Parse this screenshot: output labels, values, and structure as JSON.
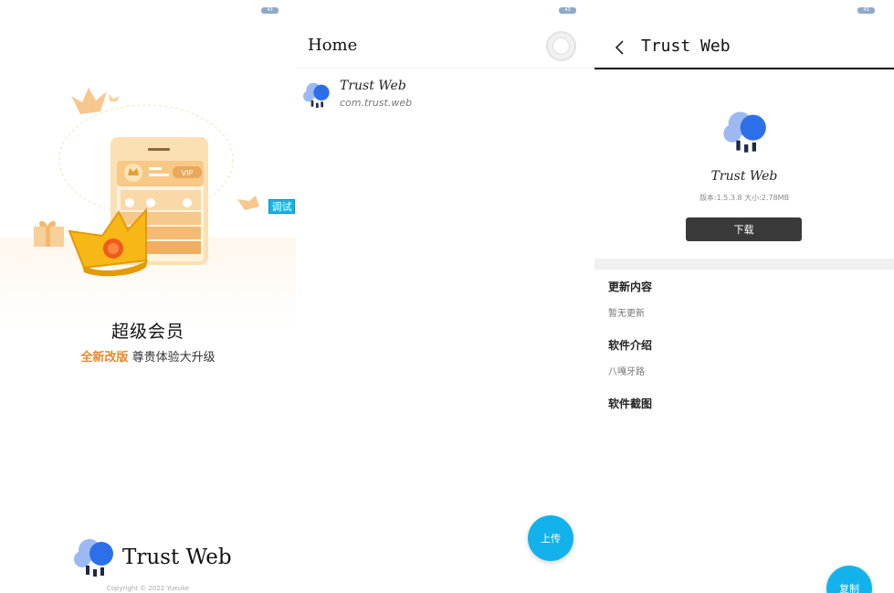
{
  "status": {
    "battery": "43"
  },
  "splash": {
    "debug_badge": "调试",
    "vip_card_label": "VIP",
    "title": "超级会员",
    "subtitle_highlight": "全新改版",
    "subtitle_rest": " 尊贵体验大升级",
    "brand": "Trust Web",
    "copyright": "Copyright © 2022 Yueuke"
  },
  "home": {
    "title": "Home",
    "apps": [
      {
        "name": "Trust Web",
        "package": "com.trust.web"
      }
    ],
    "upload_label": "上传"
  },
  "detail": {
    "title": "Trust Web",
    "app_name": "Trust Web",
    "meta": "版本:1.5.3.8 大小:2.78MB",
    "download_label": "下载",
    "sections": [
      {
        "title": "更新内容",
        "text": "暂无更新"
      },
      {
        "title": "软件介绍",
        "text": "八嘎牙路"
      },
      {
        "title": "软件截图",
        "text": ""
      }
    ],
    "copy_label": "复制"
  },
  "colors": {
    "accent": "#14b2ec",
    "brand_blue": "#2d6fe8",
    "highlight": "#e48b2c",
    "button_dark": "#3a3a3a"
  }
}
